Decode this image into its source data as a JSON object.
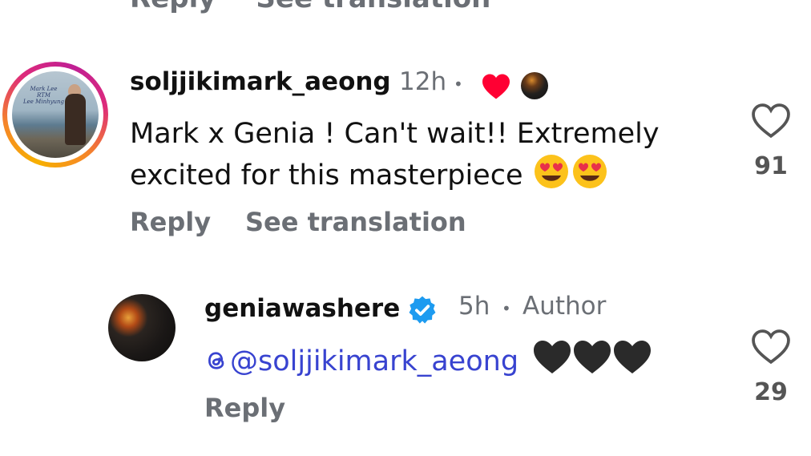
{
  "top_partial": {
    "reply": "Reply",
    "see_translation": "See translation"
  },
  "comments": [
    {
      "username": "soljjikimark_aeong",
      "time": "12h",
      "avatar_text": [
        "Mark Lee",
        "RTM",
        "Lee Minhyung"
      ],
      "text_line1": "Mark x Genia ! Can't wait!! Extremely",
      "text_line2": "excited for this masterpiece",
      "reply": "Reply",
      "see_translation": "See translation",
      "likes": "91"
    },
    {
      "username": "geniawashere",
      "time": "5h",
      "author_label": "Author",
      "mention": "@soljjikimark_aeong",
      "reply": "Reply",
      "likes": "29"
    }
  ],
  "icons": {
    "heart_outline": "heart-outline-icon",
    "liked_heart": "red-heart-icon",
    "verified": "verified-badge-icon",
    "threads": "threads-icon"
  },
  "colors": {
    "liked_heart": "#ff0033",
    "mention": "#3843d0",
    "verified": "#1d9bf0"
  }
}
